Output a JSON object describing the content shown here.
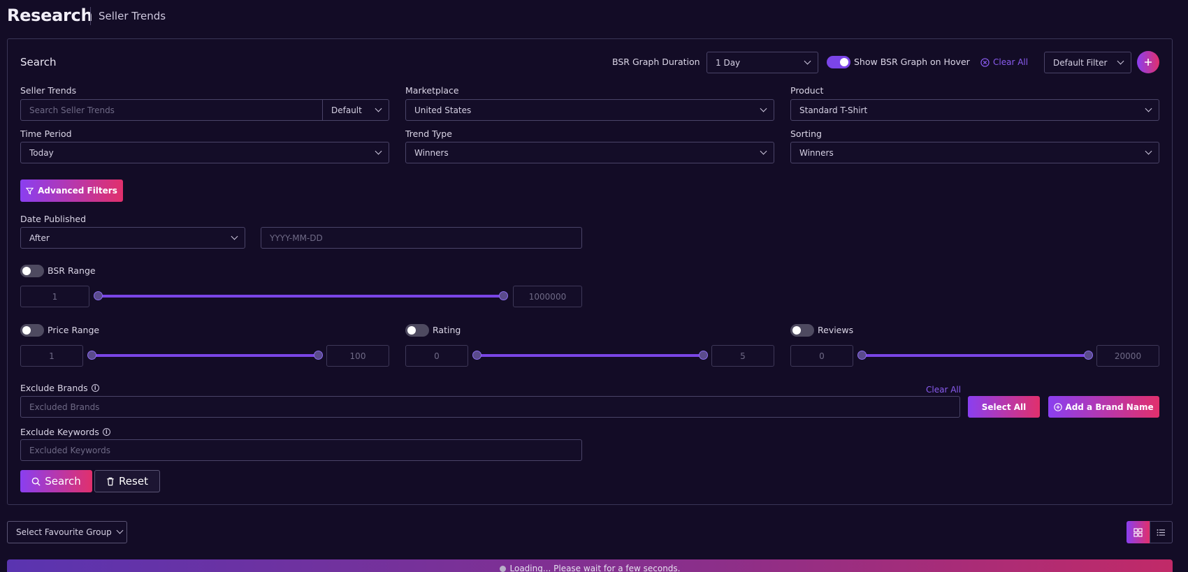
{
  "header": {
    "title": "Research",
    "subtitle": "Seller Trends"
  },
  "search_panel": {
    "title": "Search",
    "bsr_duration_label": "BSR Graph Duration",
    "bsr_duration_value": "1 Day",
    "show_bsr_hover_label": "Show BSR Graph on Hover",
    "show_bsr_hover_on": true,
    "clear_all_label": "Clear All",
    "default_filter_value": "Default Filter",
    "add_icon": "plus-icon"
  },
  "fields": {
    "seller_trends": {
      "label": "Seller Trends",
      "placeholder": "Search Seller Trends",
      "mode": "Default"
    },
    "marketplace": {
      "label": "Marketplace",
      "value": "United States"
    },
    "product": {
      "label": "Product",
      "value": "Standard T-Shirt"
    },
    "time_period": {
      "label": "Time Period",
      "value": "Today"
    },
    "trend_type": {
      "label": "Trend Type",
      "value": "Winners"
    },
    "sorting": {
      "label": "Sorting",
      "value": "Winners"
    }
  },
  "advanced_filters_label": "Advanced Filters",
  "date_published": {
    "label": "Date Published",
    "value": "After",
    "date_placeholder": "YYYY-MM-DD"
  },
  "ranges": {
    "bsr": {
      "label": "BSR Range",
      "min": "1",
      "max": "1000000"
    },
    "price": {
      "label": "Price Range",
      "min": "1",
      "max": "100"
    },
    "rating": {
      "label": "Rating",
      "min": "0",
      "max": "5"
    },
    "reviews": {
      "label": "Reviews",
      "min": "0",
      "max": "20000"
    }
  },
  "exclude_brands": {
    "label": "Exclude Brands",
    "placeholder": "Excluded Brands",
    "clear_all": "Clear All",
    "select_all": "Select All",
    "add_brand": "Add a Brand Name"
  },
  "exclude_keywords": {
    "label": "Exclude Keywords",
    "placeholder": "Excluded Keywords"
  },
  "actions": {
    "search": "Search",
    "reset": "Reset"
  },
  "bottom": {
    "favourite_group": "Select Favourite Group",
    "loading": "Loading... Please wait for a few seconds."
  },
  "colors": {
    "accent": "#7b45e8",
    "gradient_start": "#8a3ff0",
    "gradient_end": "#e1306c",
    "background": "#130c26"
  }
}
